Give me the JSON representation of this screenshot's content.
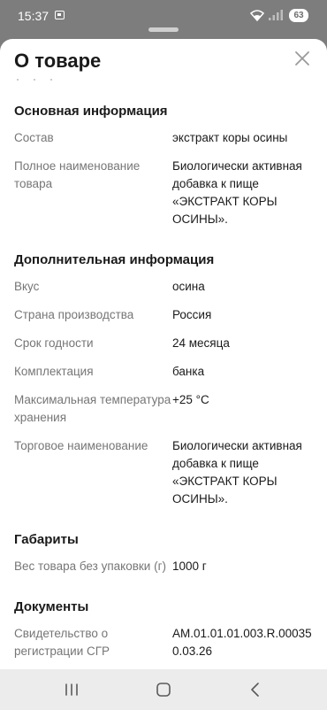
{
  "status_bar": {
    "time": "15:37",
    "battery": "63"
  },
  "sheet": {
    "title": "О товаре"
  },
  "sections": [
    {
      "title": "Основная информация",
      "rows": [
        {
          "label": "Состав",
          "value": "экстракт коры осины"
        },
        {
          "label": "Полное наименование товара",
          "value": "Биологически активная добавка к пище «ЭКСТРАКТ КОРЫ ОСИНЫ»."
        }
      ]
    },
    {
      "title": "Дополнительная информация",
      "rows": [
        {
          "label": "Вкус",
          "value": "осина"
        },
        {
          "label": "Страна производства",
          "value": "Россия"
        },
        {
          "label": "Срок годности",
          "value": "24 месяца"
        },
        {
          "label": "Комплектация",
          "value": "банка"
        },
        {
          "label": "Максимальная температура хранения",
          "value": "+25 °С"
        },
        {
          "label": "Торговое наименование",
          "value": "Биологически активная добавка к пище «ЭКСТРАКТ КОРЫ ОСИНЫ»."
        }
      ]
    },
    {
      "title": "Габариты",
      "rows": [
        {
          "label": "Вес товара без упаковки (г)",
          "value": "1000 г"
        }
      ]
    },
    {
      "title": "Документы",
      "rows": [
        {
          "label": "Свидетельство о регистрации СГР",
          "value": "AM.01.01.01.003.R.000350.03.26"
        }
      ]
    }
  ],
  "nav": {
    "recents_icon": "recents-icon",
    "home_icon": "home-icon",
    "back_icon": "back-icon"
  }
}
